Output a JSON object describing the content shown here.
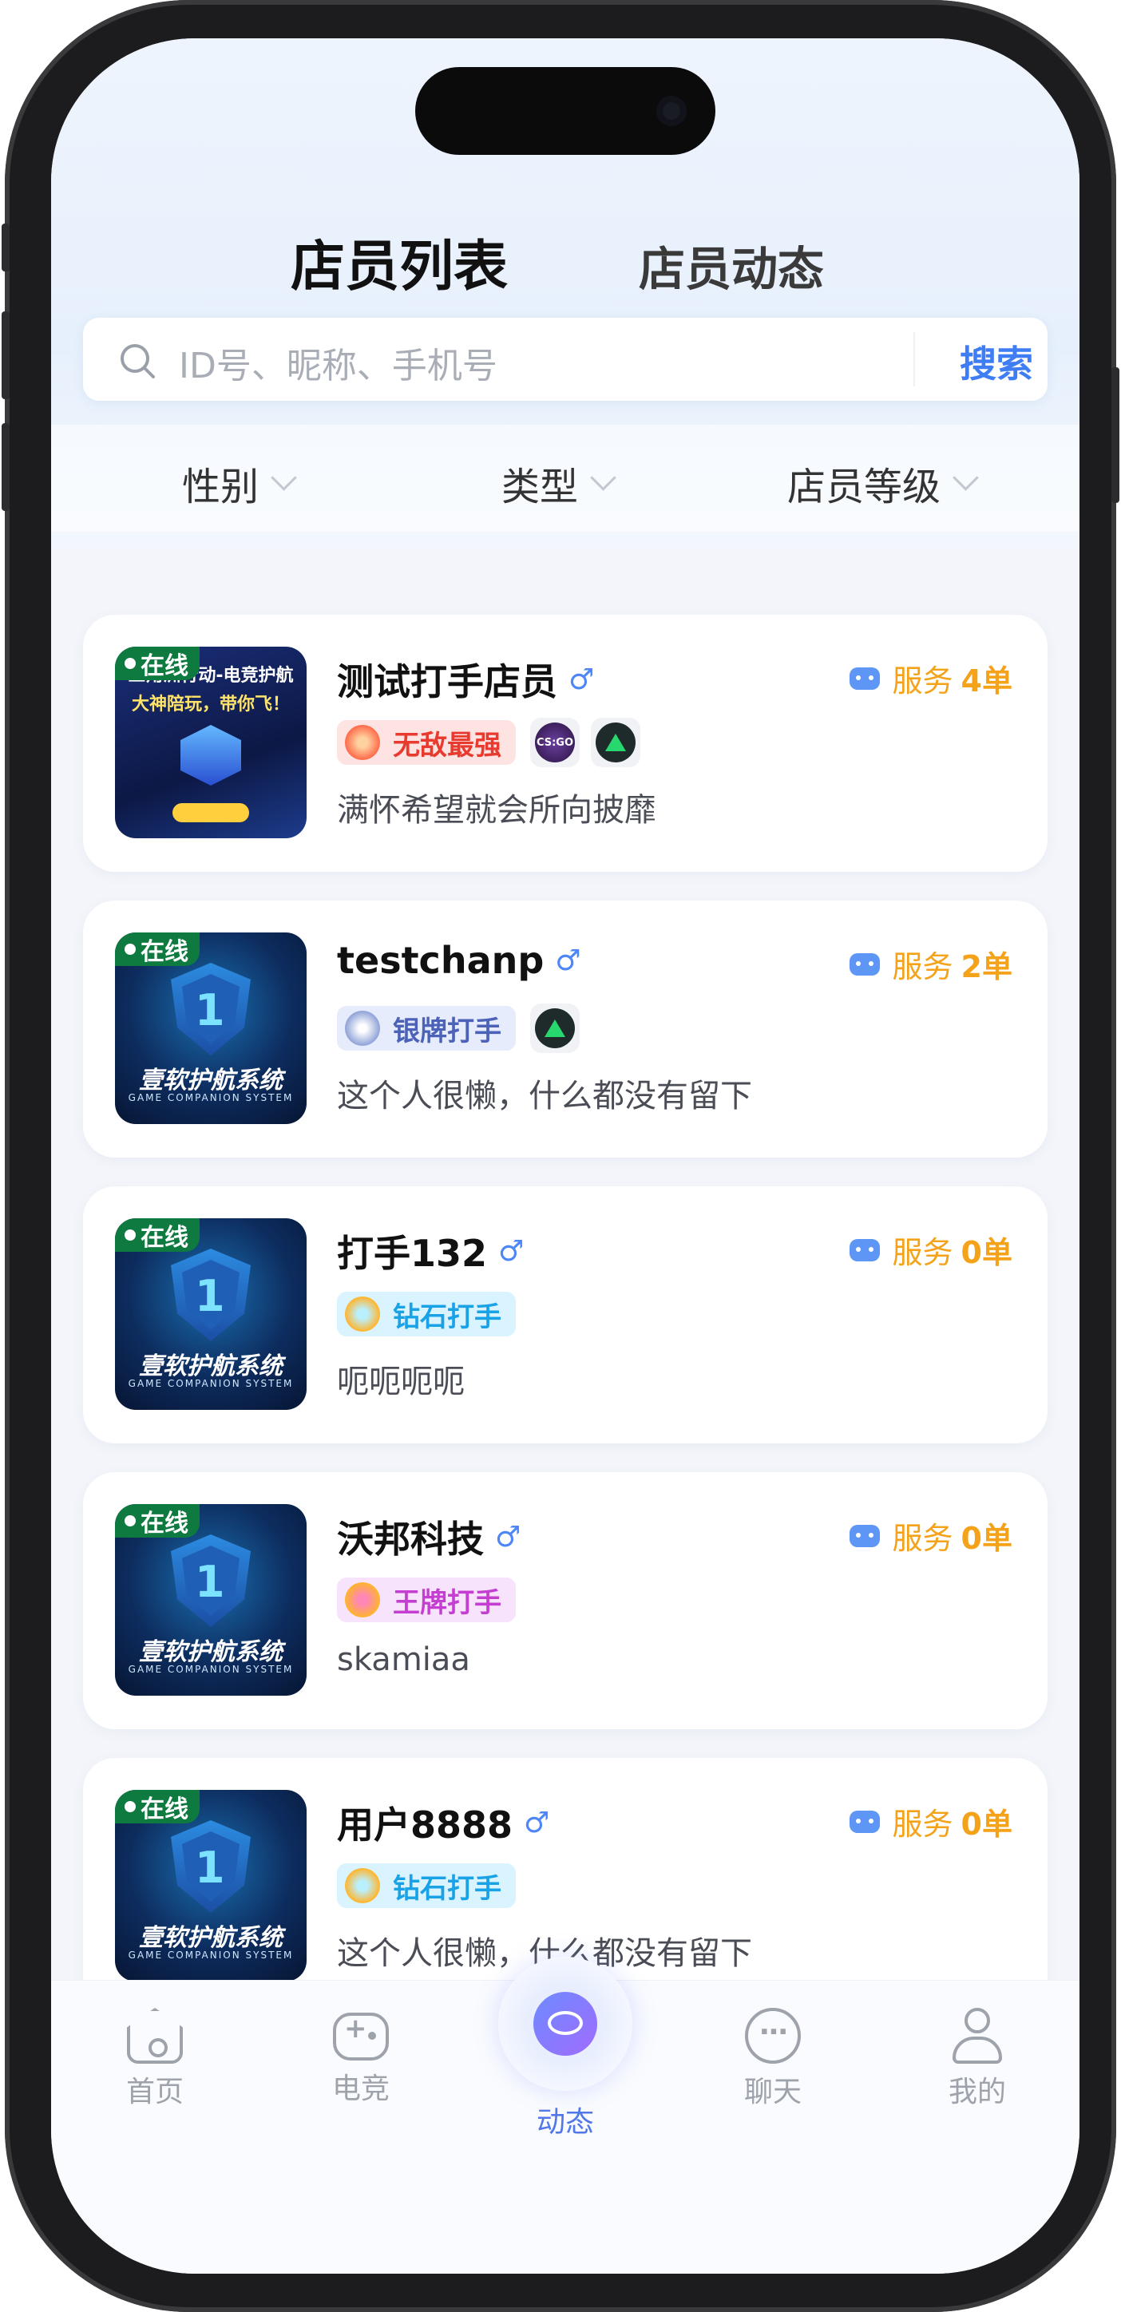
{
  "header": {
    "tabs": [
      {
        "label": "店员列表",
        "active": true
      },
      {
        "label": "店员动态",
        "active": false
      }
    ]
  },
  "search": {
    "placeholder": "ID号、昵称、手机号",
    "button_label": "搜索"
  },
  "filters": [
    {
      "label": "性别"
    },
    {
      "label": "类型"
    },
    {
      "label": "店员等级"
    }
  ],
  "staff": [
    {
      "online_label": "在线",
      "name": "测试打手店员",
      "gender_symbol": "♂",
      "service_label": "服务",
      "service_count": "4单",
      "rank_label": "无敌最强",
      "rank_style": "strongest",
      "games": [
        "csgo",
        "delta"
      ],
      "bio": "满怀希望就会所向披靡",
      "avatar_text": {
        "title": "三角洲行动-电竞护航",
        "subtitle": "大神陪玩，带你飞！"
      }
    },
    {
      "online_label": "在线",
      "name": "testchanp",
      "gender_symbol": "♂",
      "service_label": "服务",
      "service_count": "2单",
      "rank_label": "银牌打手",
      "rank_style": "silver",
      "games": [
        "delta"
      ],
      "bio": "这个人很懒，什么都没有留下",
      "avatar_text": {
        "brand": "壹软护航系统",
        "brand_sub": "GAME COMPANION SYSTEM"
      }
    },
    {
      "online_label": "在线",
      "name": "打手132",
      "gender_symbol": "♂",
      "service_label": "服务",
      "service_count": "0单",
      "rank_label": "钻石打手",
      "rank_style": "diamond",
      "games": [],
      "bio": "呃呃呃呃",
      "avatar_text": {
        "brand": "壹软护航系统",
        "brand_sub": "GAME COMPANION SYSTEM"
      }
    },
    {
      "online_label": "在线",
      "name": "沃邦科技",
      "gender_symbol": "♂",
      "service_label": "服务",
      "service_count": "0单",
      "rank_label": "王牌打手",
      "rank_style": "ace",
      "games": [],
      "bio": "skamiaa",
      "avatar_text": {
        "brand": "壹软护航系统",
        "brand_sub": "GAME COMPANION SYSTEM"
      }
    },
    {
      "online_label": "在线",
      "name": "用户8888",
      "gender_symbol": "♂",
      "service_label": "服务",
      "service_count": "0单",
      "rank_label": "钻石打手",
      "rank_style": "diamond",
      "games": [],
      "bio": "这个人很懒，什么都没有留下",
      "avatar_text": {
        "brand": "壹软护航系统",
        "brand_sub": "GAME COMPANION SYSTEM"
      }
    }
  ],
  "tabbar": {
    "items": [
      {
        "label": "首页",
        "icon": "home-icon"
      },
      {
        "label": "电竞",
        "icon": "gamepad-icon"
      },
      {
        "label": "动态",
        "icon": "planet-icon",
        "active": true
      },
      {
        "label": "聊天",
        "icon": "chat-icon"
      },
      {
        "label": "我的",
        "icon": "user-icon"
      }
    ]
  },
  "colors": {
    "accent": "#3f7df4",
    "service": "#f4a219",
    "online": "#0f7a3f"
  }
}
